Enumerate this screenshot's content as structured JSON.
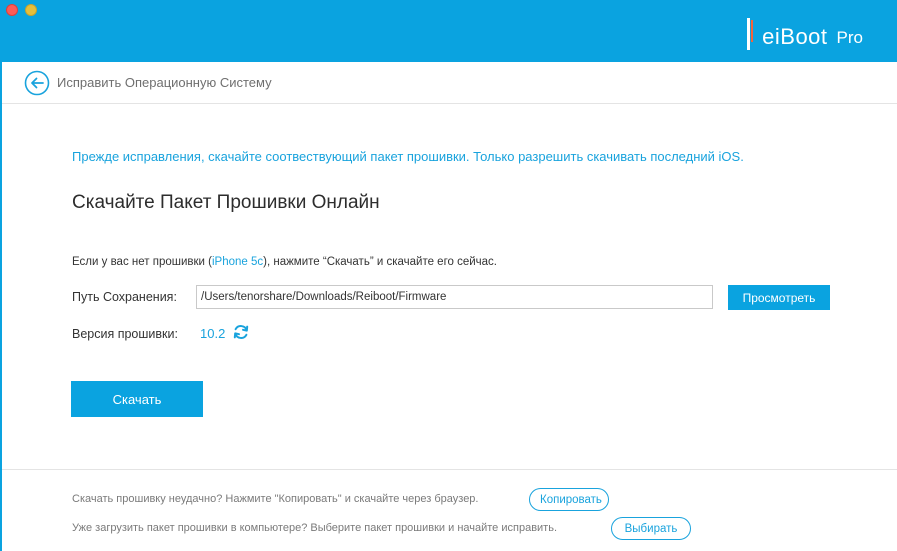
{
  "titlebar": {
    "logo_text": "eiBoot",
    "logo_edition": "Pro"
  },
  "header": {
    "title": "Исправить Операционную Систему"
  },
  "main": {
    "notice": "Прежде исправления, скачайте соотвествующий пакет прошивки. Только разрешить скачивать последний iOS.",
    "section_title": "Скачайте Пакет Прошивки Онлайн",
    "hint_before": "Если у вас нет прошивки (",
    "hint_device": "iPhone 5c",
    "hint_after": "), нажмите “Скачать” и скачайте его сейчас.",
    "path_label": "Путь Сохранения:",
    "path_value": "/Users/tenorshare/Downloads/Reiboot/Firmware",
    "browse_label": "Просмотреть",
    "version_label": "Версия прошивки:",
    "version_value": "10.2",
    "download_label": "Скачать"
  },
  "footer": {
    "copy_text": "Скачать прошивку неудачно? Нажмите \"Копировать\" и скачайте через браузер.",
    "copy_button": "Копировать",
    "choose_text": "Уже загрузить пакет прошивки в компьютере? Выберите пакет прошивки и начайте исправить.",
    "choose_button": "Выбирать"
  },
  "colors": {
    "accent": "#0aa3e0",
    "link": "#19a3dd",
    "close": "#fc5b57",
    "minimize": "#e5bf3c"
  },
  "icons": {
    "back": "back-arrow-circle-icon",
    "refresh": "refresh-icon"
  }
}
